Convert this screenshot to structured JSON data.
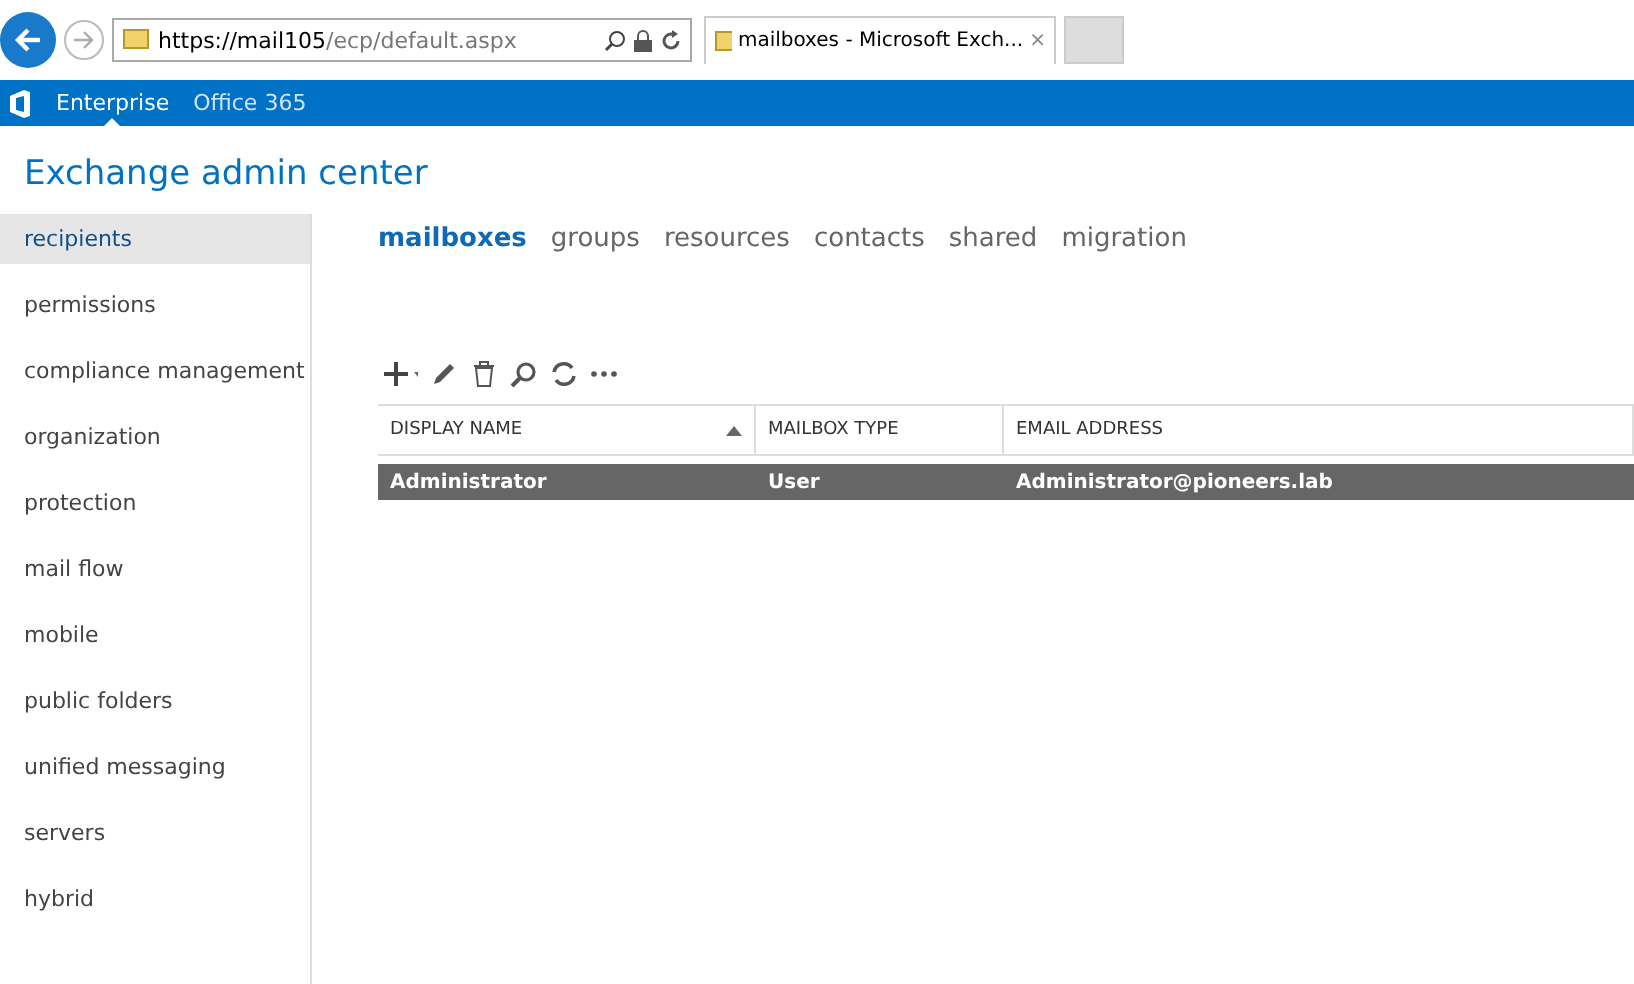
{
  "browser": {
    "address_host": "https://mail105",
    "address_path": "/ecp/default.aspx",
    "tab_title": "mailboxes - Microsoft Exch...",
    "tab_close": "×"
  },
  "top_bar": {
    "items": [
      {
        "label": "Enterprise",
        "selected": true
      },
      {
        "label": "Office 365",
        "selected": false
      }
    ]
  },
  "title": "Exchange admin center",
  "sidebar": {
    "items": [
      {
        "label": "recipients",
        "selected": true
      },
      {
        "label": "permissions",
        "selected": false
      },
      {
        "label": "compliance management",
        "selected": false
      },
      {
        "label": "organization",
        "selected": false
      },
      {
        "label": "protection",
        "selected": false
      },
      {
        "label": "mail flow",
        "selected": false
      },
      {
        "label": "mobile",
        "selected": false
      },
      {
        "label": "public folders",
        "selected": false
      },
      {
        "label": "unified messaging",
        "selected": false
      },
      {
        "label": "servers",
        "selected": false
      },
      {
        "label": "hybrid",
        "selected": false
      }
    ]
  },
  "tabs": [
    {
      "label": "mailboxes",
      "selected": true
    },
    {
      "label": "groups",
      "selected": false
    },
    {
      "label": "resources",
      "selected": false
    },
    {
      "label": "contacts",
      "selected": false
    },
    {
      "label": "shared",
      "selected": false
    },
    {
      "label": "migration",
      "selected": false
    }
  ],
  "table": {
    "columns": [
      {
        "label": "DISPLAY NAME",
        "sorted": true
      },
      {
        "label": "MAILBOX TYPE",
        "sorted": false
      },
      {
        "label": "EMAIL ADDRESS",
        "sorted": false
      }
    ],
    "rows": [
      {
        "cells": [
          "Administrator",
          "User",
          "Administrator@pioneers.lab"
        ],
        "selected": true
      }
    ]
  }
}
